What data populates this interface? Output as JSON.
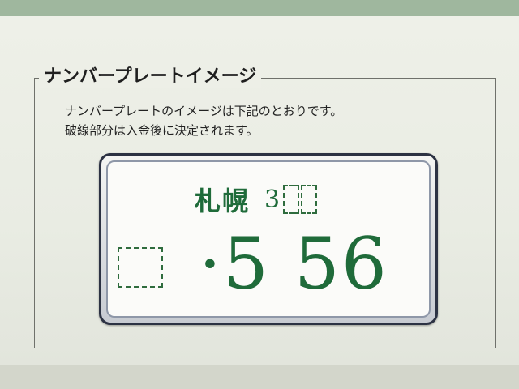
{
  "section": {
    "title": "ナンバープレートイメージ",
    "description_line1": "ナンバープレートのイメージは下記のとおりです。",
    "description_line2": "破線部分は入金後に決定されます。"
  },
  "plate": {
    "region": "札幌",
    "class_number": "3",
    "number": "·5 56",
    "text_color": "#1f6b3a",
    "plate_color": "#fbfbf9"
  }
}
